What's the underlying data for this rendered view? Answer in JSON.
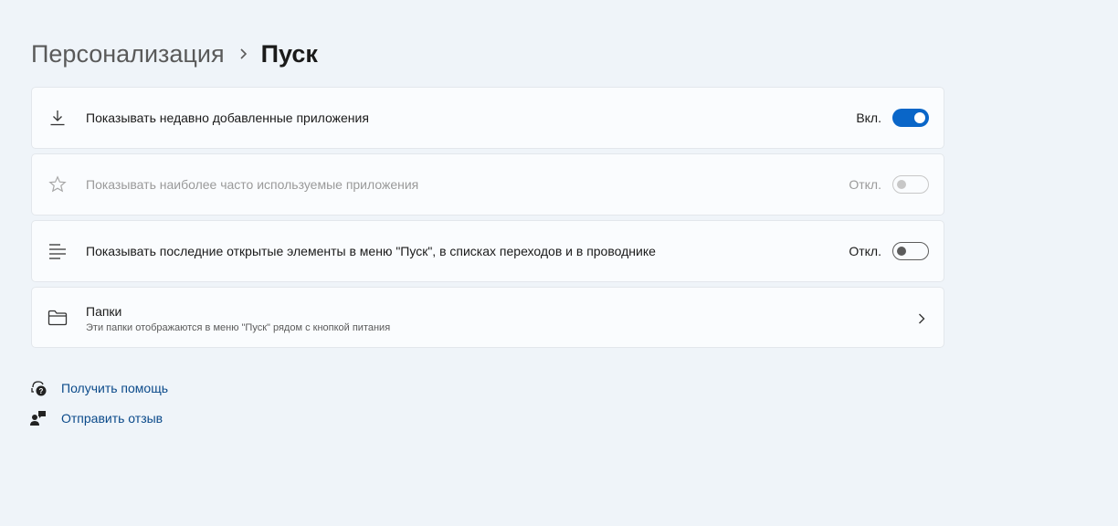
{
  "breadcrumb": {
    "parent": "Персонализация",
    "current": "Пуск"
  },
  "settings": [
    {
      "icon": "download-icon",
      "label": "Показывать недавно добавленные приложения",
      "state": "Вкл.",
      "toggle_on": true,
      "disabled": false
    },
    {
      "icon": "star-icon",
      "label": "Показывать наиболее часто используемые приложения",
      "state": "Откл.",
      "toggle_on": false,
      "disabled": true
    },
    {
      "icon": "list-icon",
      "label": "Показывать последние открытые элементы в меню \"Пуск\", в списках переходов и в проводнике",
      "state": "Откл.",
      "toggle_on": false,
      "disabled": false
    }
  ],
  "folders": {
    "icon": "folder-icon",
    "title": "Папки",
    "subtitle": "Эти папки отображаются в меню \"Пуск\" рядом с кнопкой питания"
  },
  "links": {
    "help": {
      "icon": "help-icon",
      "label": "Получить помощь"
    },
    "feedback": {
      "icon": "feedback-icon",
      "label": "Отправить отзыв"
    }
  },
  "colors": {
    "accent": "#0a66c8",
    "background": "#eff4f9",
    "card": "#fafcfe",
    "link": "#0b4a8a"
  }
}
